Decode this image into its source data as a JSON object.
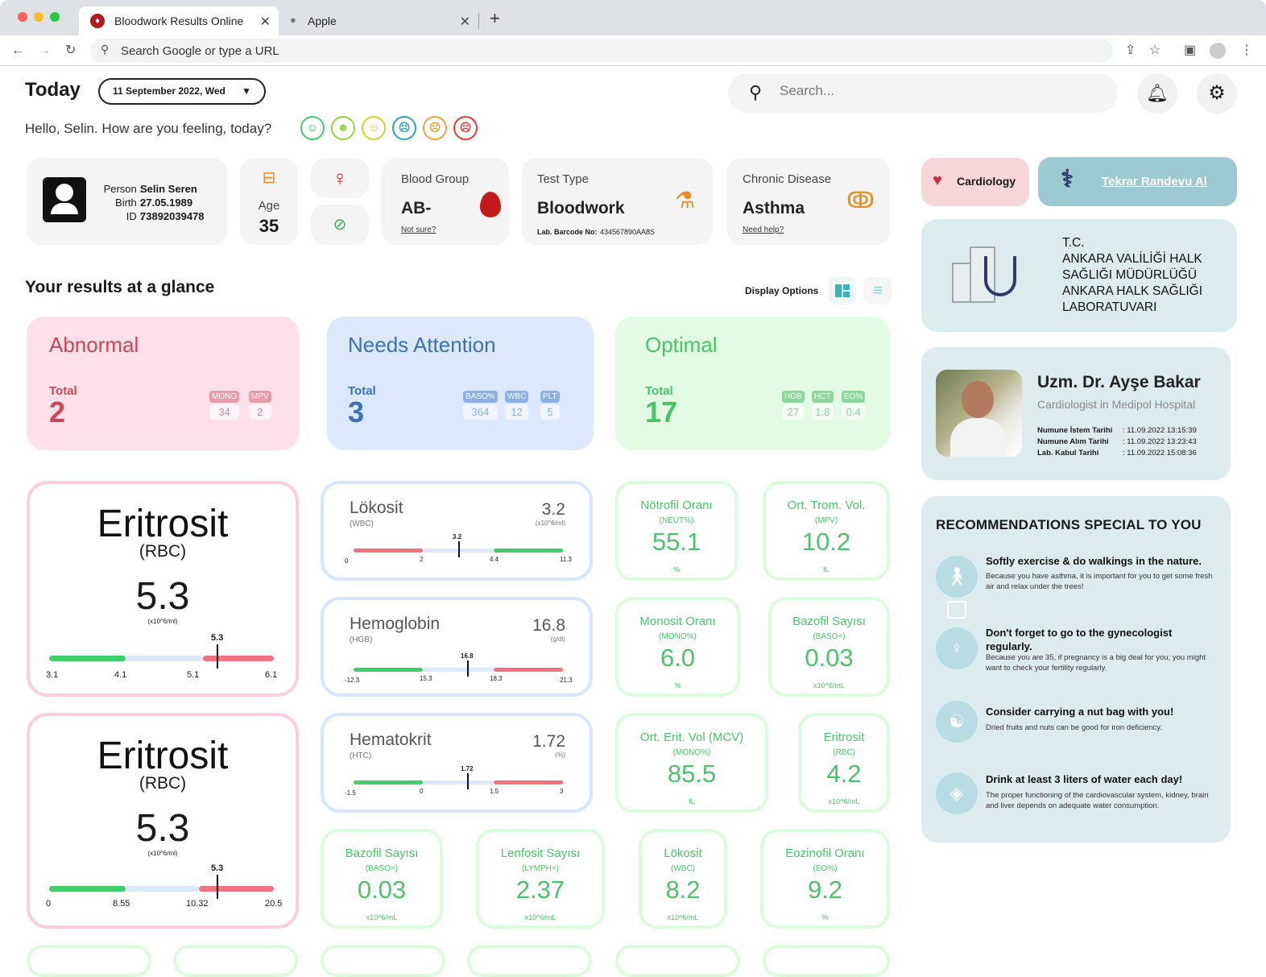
{
  "browser": {
    "tabs": [
      {
        "label": "Bloodwork Results Online"
      },
      {
        "label": "Apple"
      }
    ],
    "address": "Search Google or type a URL"
  },
  "header": {
    "title": "Today",
    "date": "11 September 2022, Wed",
    "greeting": "Hello, Selin. How are you feeling, today?",
    "search_placeholder": "Search..."
  },
  "moods": [
    {
      "glyph": "☺",
      "color": "#3fcf6a"
    },
    {
      "glyph": "☻",
      "color": "#98d33a"
    },
    {
      "glyph": "☺",
      "color": "#cfd42e"
    },
    {
      "glyph": "☹",
      "color": "#2e9fcf"
    },
    {
      "glyph": "☹",
      "color": "#f0a13a"
    },
    {
      "glyph": "☹",
      "color": "#e8393a"
    }
  ],
  "profile": {
    "person_label": "Person :",
    "person": "Selin Seren",
    "birth_label": "Birth :",
    "birth": "27.05.1989",
    "id_label": "ID :",
    "id": "73892039478",
    "age_label": "Age",
    "age": "35"
  },
  "blood_group": {
    "label": "Blood Group",
    "value": "AB-",
    "link": "Not sure?"
  },
  "test_type": {
    "label": "Test Type",
    "value": "Bloodwork",
    "barcode_label": "Lab. Barcode No:",
    "barcode": "434567890AA8S"
  },
  "chronic": {
    "label": "Chronic Disease",
    "value": "Asthma",
    "link": "Need help?"
  },
  "results": {
    "title": "Your results at a glance",
    "display_options": "Display Options"
  },
  "summary": {
    "abnormal": {
      "title": "Abnormal",
      "total_label": "Total",
      "total": "2",
      "chips": [
        {
          "label": "MONO",
          "value": "34"
        },
        {
          "label": "MPV",
          "value": "2"
        }
      ]
    },
    "attention": {
      "title": "Needs Attention",
      "total_label": "Total",
      "total": "3",
      "chips": [
        {
          "label": "BASO%",
          "value": "364"
        },
        {
          "label": "WBC",
          "value": "12"
        },
        {
          "label": "PLT",
          "value": "5"
        }
      ]
    },
    "optimal": {
      "title": "Optimal",
      "total_label": "Total",
      "total": "17",
      "chips": [
        {
          "label": "HGB",
          "value": "27"
        },
        {
          "label": "HCT",
          "value": "1.8"
        },
        {
          "label": "EO%",
          "value": "0.4"
        }
      ]
    }
  },
  "rbc_cards": [
    {
      "name": "Eritrosit",
      "sub": "(RBC)",
      "value": "5.3",
      "unit": "(x10^6/ml)",
      "marker": "5.3",
      "ticks": [
        "3.1",
        "4.1",
        "5.1",
        "6.1"
      ]
    },
    {
      "name": "Eritrosit",
      "sub": "(RBC)",
      "value": "5.3",
      "unit": "(x10^6/ml)",
      "marker": "5.3",
      "ticks": [
        "0",
        "8.55",
        "10.32",
        "20.5"
      ]
    }
  ],
  "mid_cards": [
    {
      "name": "Lökosit",
      "sub": "(WBC)",
      "value": "3.2",
      "unit": "(x10^6/ml)",
      "marker": "3.2",
      "ticks": [
        "0",
        "2",
        "4.4",
        "11.3"
      ]
    },
    {
      "name": "Hemoglobin",
      "sub": "(HGB)",
      "value": "16.8",
      "unit": "(g/dl)",
      "marker": "16.8",
      "ticks": [
        "-12.3",
        "15.3",
        "18.3",
        "21.3"
      ]
    },
    {
      "name": "Hematokrit",
      "sub": "(HTC)",
      "value": "1.72",
      "unit": "(%)",
      "marker": "1.72",
      "ticks": [
        "-1.5",
        "0",
        "1.5",
        "3"
      ]
    }
  ],
  "green_cards": [
    {
      "name": "Nötrofil Oranı",
      "sub": "(NEUT%)",
      "value": "55.1",
      "unit": "%"
    },
    {
      "name": "Ort. Trom. Vol.",
      "sub": "(MPV)",
      "value": "10.2",
      "unit": "fL"
    },
    {
      "name": "Monosit Oranı",
      "sub": "(MONO%)",
      "value": "6.0",
      "unit": "%"
    },
    {
      "name": "Bazofil Sayısı",
      "sub": "(BASO=)",
      "value": "0.03",
      "unit": "x10^6/mL"
    },
    {
      "name": "Ort. Erit. Vol (MCV)",
      "sub": "(MONO%)",
      "value": "85.5",
      "unit": "fL"
    },
    {
      "name": "Eritrosit",
      "sub": "(RBC)",
      "value": "4.2",
      "unit": "x10^6/mL"
    },
    {
      "name": "Bazofil Sayısı",
      "sub": "(BASO=)",
      "value": "0.03",
      "unit": "x10^6/mL"
    },
    {
      "name": "Lenfosit Sayısı",
      "sub": "(LYMPH=)",
      "value": "2.37",
      "unit": "x10^6/mL"
    },
    {
      "name": "Lökosit",
      "sub": "(WBC)",
      "value": "8.2",
      "unit": "x10^6/mL"
    },
    {
      "name": "Eozinofil Oranı",
      "sub": "(EO%)",
      "value": "9.2",
      "unit": "%"
    }
  ],
  "side": {
    "cardiology": "Cardiology",
    "appointment": "Tekrar Randevu Al",
    "lab_name": "T.C.\nANKARA VALİLİĞİ HALK\nSAĞLIĞI MÜDÜRLÜĞÜ\nANKARA HALK SAĞLIĞI\nLABORATUVARI",
    "doctor": {
      "name": "Uzm. Dr. Ayşe Bakar",
      "title": "Cardiologist in Medipol Hospital",
      "rows": [
        {
          "label": "Numune İstem Tarihi",
          "value": ": 11.09.2022 13:15:39"
        },
        {
          "label": "Numune Alım Tarihi",
          "value": ": 11.09.2022 13:23:43"
        },
        {
          "label": "Lab. Kabul Tarihi",
          "value": ": 11.09.2022 15:08:36"
        }
      ]
    },
    "rec_title": "RECOMMENDATIONS SPECIAL TO YOU",
    "recs": [
      {
        "title": "Softly exercise & do walkings in the nature.",
        "desc": "Because you have asthma, it is important for you to get some fresh air and relax under the trees!"
      },
      {
        "title": "Don't forget to go to the gynecologist regularly.",
        "desc": "Because you are 35, if pregnancy is a big deal for you; you might want to check your fertility regularly."
      },
      {
        "title": "Consider carrying a nut bag with you!",
        "desc": "Dried fruits and nuts can be good for iron deficiency."
      },
      {
        "title": "Drink at least 3 liters of water each day!",
        "desc": "The proper functioning of the cardiovascular system, kidney, brain and liver depends on adequate water consumption."
      }
    ]
  },
  "colors": {
    "abnormal": "#fbe0ea",
    "attention": "#dce9fd",
    "optimal": "#e2fbe2",
    "accent_green": "#4ac46a",
    "accent_red": "#e8607a"
  }
}
